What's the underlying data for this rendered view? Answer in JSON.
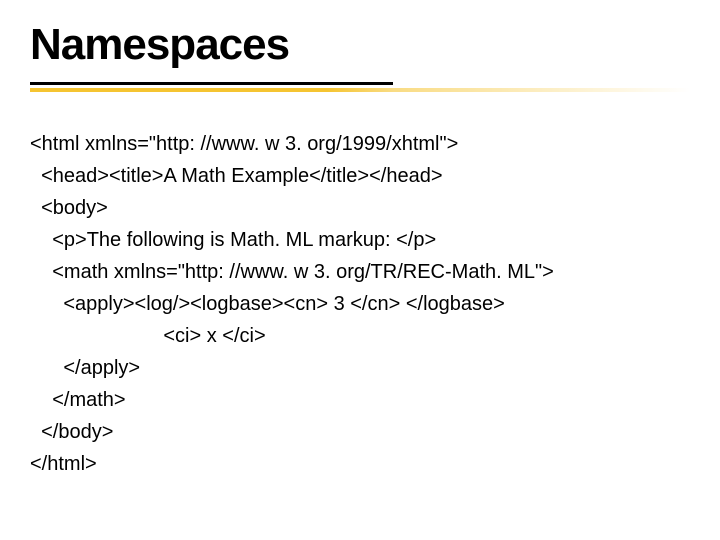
{
  "title": "Namespaces",
  "code_lines": [
    "<html xmlns=\"http: //www. w 3. org/1999/xhtml\">",
    "  <head><title>A Math Example</title></head>",
    "  <body>",
    "    <p>The following is Math. ML markup: </p>",
    "    <math xmlns=\"http: //www. w 3. org/TR/REC-Math. ML\">",
    "      <apply><log/><logbase><cn> 3 </cn> </logbase>",
    "                        <ci> x </ci>",
    "      </apply>",
    "    </math>",
    "  </body>",
    "</html>"
  ]
}
